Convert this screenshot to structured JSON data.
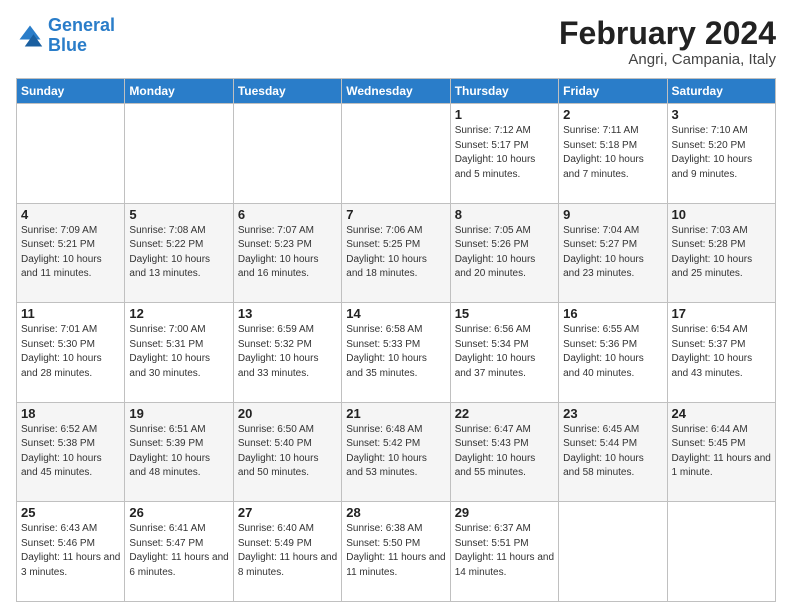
{
  "logo": {
    "line1": "General",
    "line2": "Blue"
  },
  "title": "February 2024",
  "subtitle": "Angri, Campania, Italy",
  "weekdays": [
    "Sunday",
    "Monday",
    "Tuesday",
    "Wednesday",
    "Thursday",
    "Friday",
    "Saturday"
  ],
  "weeks": [
    [
      {
        "day": "",
        "info": ""
      },
      {
        "day": "",
        "info": ""
      },
      {
        "day": "",
        "info": ""
      },
      {
        "day": "",
        "info": ""
      },
      {
        "day": "1",
        "info": "Sunrise: 7:12 AM\nSunset: 5:17 PM\nDaylight: 10 hours\nand 5 minutes."
      },
      {
        "day": "2",
        "info": "Sunrise: 7:11 AM\nSunset: 5:18 PM\nDaylight: 10 hours\nand 7 minutes."
      },
      {
        "day": "3",
        "info": "Sunrise: 7:10 AM\nSunset: 5:20 PM\nDaylight: 10 hours\nand 9 minutes."
      }
    ],
    [
      {
        "day": "4",
        "info": "Sunrise: 7:09 AM\nSunset: 5:21 PM\nDaylight: 10 hours\nand 11 minutes."
      },
      {
        "day": "5",
        "info": "Sunrise: 7:08 AM\nSunset: 5:22 PM\nDaylight: 10 hours\nand 13 minutes."
      },
      {
        "day": "6",
        "info": "Sunrise: 7:07 AM\nSunset: 5:23 PM\nDaylight: 10 hours\nand 16 minutes."
      },
      {
        "day": "7",
        "info": "Sunrise: 7:06 AM\nSunset: 5:25 PM\nDaylight: 10 hours\nand 18 minutes."
      },
      {
        "day": "8",
        "info": "Sunrise: 7:05 AM\nSunset: 5:26 PM\nDaylight: 10 hours\nand 20 minutes."
      },
      {
        "day": "9",
        "info": "Sunrise: 7:04 AM\nSunset: 5:27 PM\nDaylight: 10 hours\nand 23 minutes."
      },
      {
        "day": "10",
        "info": "Sunrise: 7:03 AM\nSunset: 5:28 PM\nDaylight: 10 hours\nand 25 minutes."
      }
    ],
    [
      {
        "day": "11",
        "info": "Sunrise: 7:01 AM\nSunset: 5:30 PM\nDaylight: 10 hours\nand 28 minutes."
      },
      {
        "day": "12",
        "info": "Sunrise: 7:00 AM\nSunset: 5:31 PM\nDaylight: 10 hours\nand 30 minutes."
      },
      {
        "day": "13",
        "info": "Sunrise: 6:59 AM\nSunset: 5:32 PM\nDaylight: 10 hours\nand 33 minutes."
      },
      {
        "day": "14",
        "info": "Sunrise: 6:58 AM\nSunset: 5:33 PM\nDaylight: 10 hours\nand 35 minutes."
      },
      {
        "day": "15",
        "info": "Sunrise: 6:56 AM\nSunset: 5:34 PM\nDaylight: 10 hours\nand 37 minutes."
      },
      {
        "day": "16",
        "info": "Sunrise: 6:55 AM\nSunset: 5:36 PM\nDaylight: 10 hours\nand 40 minutes."
      },
      {
        "day": "17",
        "info": "Sunrise: 6:54 AM\nSunset: 5:37 PM\nDaylight: 10 hours\nand 43 minutes."
      }
    ],
    [
      {
        "day": "18",
        "info": "Sunrise: 6:52 AM\nSunset: 5:38 PM\nDaylight: 10 hours\nand 45 minutes."
      },
      {
        "day": "19",
        "info": "Sunrise: 6:51 AM\nSunset: 5:39 PM\nDaylight: 10 hours\nand 48 minutes."
      },
      {
        "day": "20",
        "info": "Sunrise: 6:50 AM\nSunset: 5:40 PM\nDaylight: 10 hours\nand 50 minutes."
      },
      {
        "day": "21",
        "info": "Sunrise: 6:48 AM\nSunset: 5:42 PM\nDaylight: 10 hours\nand 53 minutes."
      },
      {
        "day": "22",
        "info": "Sunrise: 6:47 AM\nSunset: 5:43 PM\nDaylight: 10 hours\nand 55 minutes."
      },
      {
        "day": "23",
        "info": "Sunrise: 6:45 AM\nSunset: 5:44 PM\nDaylight: 10 hours\nand 58 minutes."
      },
      {
        "day": "24",
        "info": "Sunrise: 6:44 AM\nSunset: 5:45 PM\nDaylight: 11 hours\nand 1 minute."
      }
    ],
    [
      {
        "day": "25",
        "info": "Sunrise: 6:43 AM\nSunset: 5:46 PM\nDaylight: 11 hours\nand 3 minutes."
      },
      {
        "day": "26",
        "info": "Sunrise: 6:41 AM\nSunset: 5:47 PM\nDaylight: 11 hours\nand 6 minutes."
      },
      {
        "day": "27",
        "info": "Sunrise: 6:40 AM\nSunset: 5:49 PM\nDaylight: 11 hours\nand 8 minutes."
      },
      {
        "day": "28",
        "info": "Sunrise: 6:38 AM\nSunset: 5:50 PM\nDaylight: 11 hours\nand 11 minutes."
      },
      {
        "day": "29",
        "info": "Sunrise: 6:37 AM\nSunset: 5:51 PM\nDaylight: 11 hours\nand 14 minutes."
      },
      {
        "day": "",
        "info": ""
      },
      {
        "day": "",
        "info": ""
      }
    ]
  ]
}
